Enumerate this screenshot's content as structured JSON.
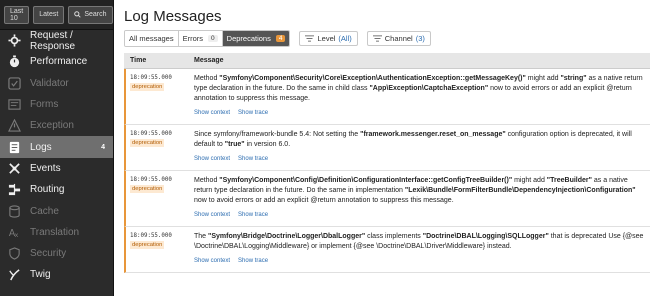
{
  "toolbar": {
    "last10": "Last 10",
    "latest": "Latest",
    "search": "Search"
  },
  "sidebar": {
    "items": [
      {
        "label": "Request / Response",
        "icon": "request-icon",
        "disabled": false
      },
      {
        "label": "Performance",
        "icon": "timer-icon",
        "disabled": false
      },
      {
        "label": "Validator",
        "icon": "check-icon",
        "disabled": true
      },
      {
        "label": "Forms",
        "icon": "form-icon",
        "disabled": true
      },
      {
        "label": "Exception",
        "icon": "exception-icon",
        "disabled": true
      },
      {
        "label": "Logs",
        "icon": "logs-icon",
        "disabled": false,
        "active": true,
        "count": "4"
      },
      {
        "label": "Events",
        "icon": "events-icon",
        "disabled": false
      },
      {
        "label": "Routing",
        "icon": "routing-icon",
        "disabled": false
      },
      {
        "label": "Cache",
        "icon": "cache-icon",
        "disabled": true
      },
      {
        "label": "Translation",
        "icon": "translation-icon",
        "disabled": true
      },
      {
        "label": "Security",
        "icon": "security-icon",
        "disabled": true
      },
      {
        "label": "Twig",
        "icon": "twig-icon",
        "disabled": false
      }
    ]
  },
  "main": {
    "title": "Log Messages",
    "tabs": [
      {
        "label": "All messages",
        "active": false
      },
      {
        "label": "Errors",
        "badge": "0",
        "active": false
      },
      {
        "label": "Deprecations",
        "badge": "4",
        "active": true
      }
    ],
    "filters": {
      "level_label": "Level",
      "level_value": "(All)",
      "channel_label": "Channel",
      "channel_value": "(3)"
    },
    "columns": {
      "time": "Time",
      "message": "Message"
    },
    "links": {
      "context": "Show context",
      "trace": "Show trace"
    },
    "rows": [
      {
        "time": "18:09:55.000",
        "level": "deprecation",
        "message": [
          {
            "t": "Method "
          },
          {
            "b": "\"Symfony\\Component\\Security\\Core\\Exception\\AuthenticationException::getMessageKey()\""
          },
          {
            "t": " might add "
          },
          {
            "b": "\"string\""
          },
          {
            "t": " as a native return type declaration in the future. Do the same in child class "
          },
          {
            "b": "\"App\\Exception\\CaptchaException\""
          },
          {
            "t": " now to avoid errors or add an explicit @return annotation to suppress this message."
          }
        ]
      },
      {
        "time": "18:09:55.000",
        "level": "deprecation",
        "message": [
          {
            "t": "Since symfony/framework-bundle 5.4: Not setting the "
          },
          {
            "b": "\"framework.messenger.reset_on_message\""
          },
          {
            "t": " configuration option is deprecated, it will default to "
          },
          {
            "b": "\"true\""
          },
          {
            "t": " in version 6.0."
          }
        ]
      },
      {
        "time": "18:09:55.000",
        "level": "deprecation",
        "message": [
          {
            "t": "Method "
          },
          {
            "b": "\"Symfony\\Component\\Config\\Definition\\ConfigurationInterface::getConfigTreeBuilder()\""
          },
          {
            "t": " might add "
          },
          {
            "b": "\"TreeBuilder\""
          },
          {
            "t": " as a native return type declaration in the future. Do the same in implementation "
          },
          {
            "b": "\"Lexik\\Bundle\\FormFilterBundle\\DependencyInjection\\Configuration\""
          },
          {
            "t": " now to avoid errors or add an explicit @return annotation to suppress this message."
          }
        ]
      },
      {
        "time": "18:09:55.000",
        "level": "deprecation",
        "message": [
          {
            "t": "The "
          },
          {
            "b": "\"Symfony\\Bridge\\Doctrine\\Logger\\DbalLogger\""
          },
          {
            "t": " class implements "
          },
          {
            "b": "\"Doctrine\\DBAL\\Logging\\SQLLogger\""
          },
          {
            "t": " that is deprecated Use {@see \\Doctrine\\DBAL\\Logging\\Middleware} or implement {@see \\Doctrine\\DBAL\\Driver\\Middleware} instead."
          }
        ]
      }
    ]
  },
  "colors": {
    "accent": "#e8963a",
    "link": "#2b6cb0",
    "sidebar_bg": "#2b2b2b"
  }
}
